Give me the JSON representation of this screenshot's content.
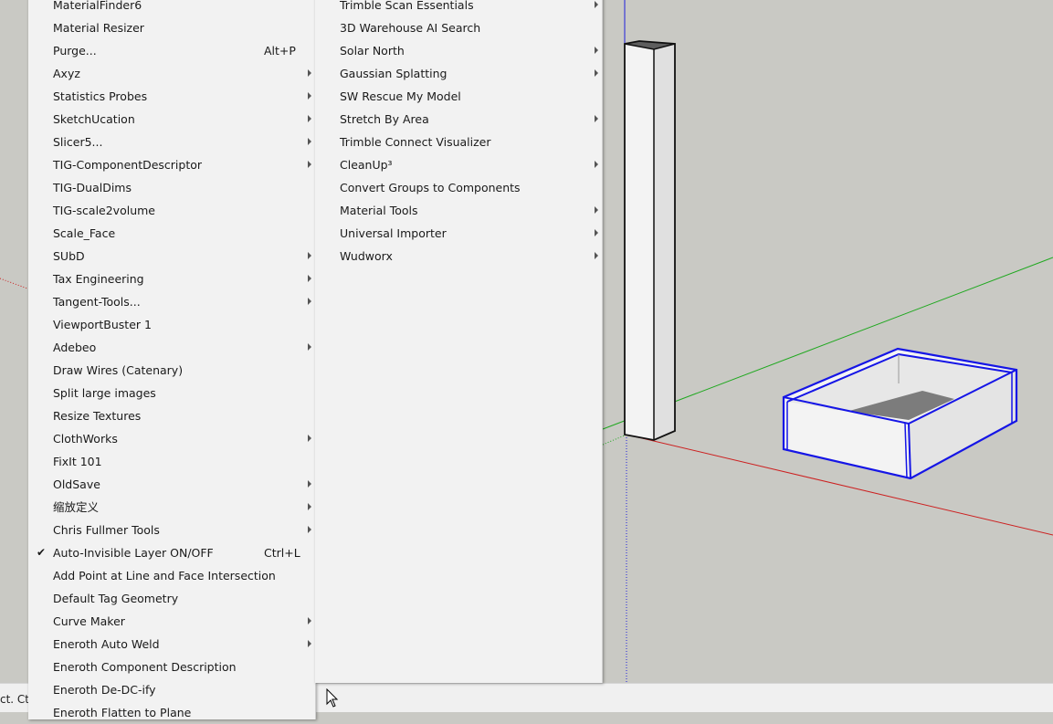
{
  "status_bar": {
    "text": "ct. Ct"
  },
  "menu_left": {
    "items": [
      {
        "label": "MaterialFinder6",
        "submenu": false
      },
      {
        "label": "Material Resizer",
        "submenu": false
      },
      {
        "label": "Purge...",
        "shortcut": "Alt+P",
        "submenu": false
      },
      {
        "label": "Axyz",
        "submenu": true
      },
      {
        "label": "Statistics Probes",
        "submenu": true
      },
      {
        "label": "SketchUcation",
        "submenu": true
      },
      {
        "label": "Slicer5...",
        "submenu": true
      },
      {
        "label": "TIG-ComponentDescriptor",
        "submenu": true
      },
      {
        "label": "TIG-DualDims",
        "submenu": false
      },
      {
        "label": "TIG-scale2volume",
        "submenu": false
      },
      {
        "label": "Scale_Face",
        "submenu": false
      },
      {
        "label": "SUbD",
        "submenu": true
      },
      {
        "label": "Tax Engineering",
        "submenu": true
      },
      {
        "label": "Tangent-Tools...",
        "submenu": true
      },
      {
        "label": "ViewportBuster 1",
        "submenu": false
      },
      {
        "label": "Adebeo",
        "submenu": true
      },
      {
        "label": "Draw Wires (Catenary)",
        "submenu": false
      },
      {
        "label": "Split large images",
        "submenu": false
      },
      {
        "label": "Resize Textures",
        "submenu": false
      },
      {
        "label": "ClothWorks",
        "submenu": true
      },
      {
        "label": "FixIt 101",
        "submenu": false
      },
      {
        "label": "OldSave",
        "submenu": true
      },
      {
        "label": "缩放定义",
        "submenu": true
      },
      {
        "label": "Chris Fullmer Tools",
        "submenu": true
      },
      {
        "label": "Auto-Invisible Layer ON/OFF",
        "shortcut": "Ctrl+L",
        "checked": true,
        "submenu": false
      },
      {
        "label": "Add Point at Line and Face Intersection",
        "submenu": false
      },
      {
        "label": "Default Tag Geometry",
        "submenu": false
      },
      {
        "label": "Curve Maker",
        "submenu": true
      },
      {
        "label": "Eneroth Auto Weld",
        "submenu": true
      },
      {
        "label": "Eneroth Component Description",
        "submenu": false
      },
      {
        "label": "Eneroth De-DC-ify",
        "submenu": false
      },
      {
        "label": "Eneroth Flatten to Plane",
        "submenu": false
      }
    ]
  },
  "menu_right": {
    "items": [
      {
        "label": "Trimble Scan Essentials",
        "submenu": true
      },
      {
        "label": "3D Warehouse AI Search",
        "submenu": false
      },
      {
        "label": "Solar North",
        "submenu": true
      },
      {
        "label": "Gaussian Splatting",
        "submenu": true
      },
      {
        "label": "SW Rescue My Model",
        "submenu": false
      },
      {
        "label": "Stretch By Area",
        "submenu": true
      },
      {
        "label": "Trimble Connect Visualizer",
        "submenu": false
      },
      {
        "label": "CleanUp³",
        "submenu": true
      },
      {
        "label": "Convert Groups to Components",
        "submenu": false
      },
      {
        "label": "Material Tools",
        "submenu": true
      },
      {
        "label": "Universal Importer",
        "submenu": true
      },
      {
        "label": "Wudworx",
        "submenu": true
      }
    ]
  },
  "colors": {
    "viewport_bg": "#c9c9c4",
    "axis_red": "#cc2020",
    "axis_green": "#1fa81f",
    "axis_blue": "#2020dd",
    "selection_blue": "#1515e6"
  }
}
